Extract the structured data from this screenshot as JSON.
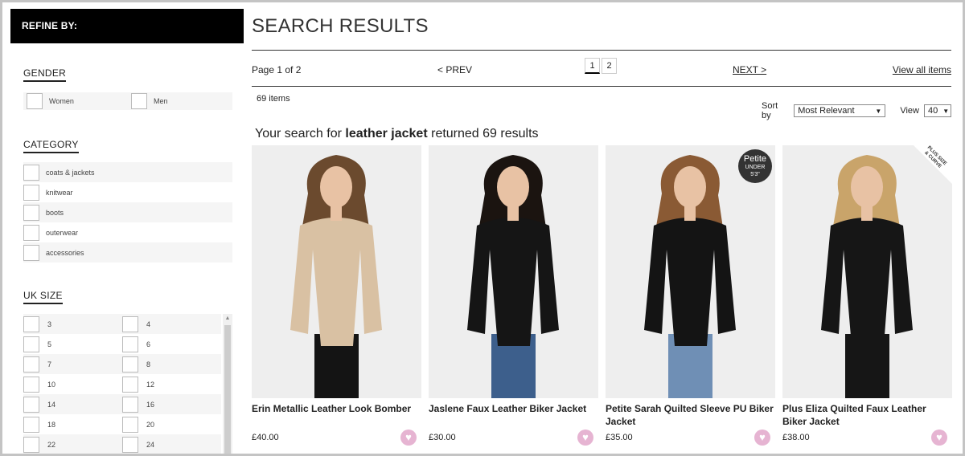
{
  "sidebar": {
    "refine_label": "REFINE BY:",
    "gender": {
      "title": "GENDER",
      "options": [
        "Women",
        "Men"
      ]
    },
    "category": {
      "title": "CATEGORY",
      "options": [
        "coats & jackets",
        "knitwear",
        "boots",
        "outerwear",
        "accessories"
      ]
    },
    "size": {
      "title": "UK SIZE",
      "rows": [
        [
          "3",
          "4"
        ],
        [
          "5",
          "6"
        ],
        [
          "7",
          "8"
        ],
        [
          "10",
          "12"
        ],
        [
          "14",
          "16"
        ],
        [
          "18",
          "20"
        ],
        [
          "22",
          "24"
        ]
      ]
    }
  },
  "main": {
    "title": "SEARCH RESULTS",
    "pager": {
      "page_info": "Page 1 of 2",
      "prev": "< PREV",
      "pages": [
        "1",
        "2"
      ],
      "next": "NEXT >",
      "view_all": "View all items"
    },
    "item_count": "69 items",
    "sort_label": "Sort by",
    "sort_value": "Most Relevant",
    "view_label": "View",
    "view_value": "40",
    "search_msg": {
      "prefix": "Your search for",
      "term": "leather jacket",
      "suffix": "returned 69 results"
    },
    "products": [
      {
        "name": "Erin Metallic Leather Look Bomber",
        "price": "£40.00",
        "jacket_color": "#d9c1a3",
        "shirt_color": "#111111",
        "bottom_color": "#141414",
        "hair_color": "#6b4a2e",
        "bg": "#eeeeee"
      },
      {
        "name": "Jaslene Faux Leather Biker Jacket",
        "price": "£30.00",
        "jacket_color": "#151515",
        "shirt_color": "#f2f2f2",
        "bottom_color": "#3d5f8c",
        "hair_color": "#1b1410",
        "bg": "#eeeeee"
      },
      {
        "name": "Petite Sarah Quilted Sleeve PU Biker Jacket",
        "price": "£35.00",
        "jacket_color": "#141414",
        "shirt_color": "#f4f4f4",
        "bottom_color": "#6f8fb5",
        "hair_color": "#8a5a34",
        "bg": "#eeeeee",
        "badge": {
          "line1": "Petite",
          "line2": "UNDER",
          "line3": "5'3\""
        }
      },
      {
        "name": "Plus Eliza Quilted Faux Leather Biker Jacket",
        "price": "£38.00",
        "jacket_color": "#161616",
        "shirt_color": "#b9b9b9",
        "bottom_color": "#161616",
        "hair_color": "#c9a46a",
        "bg": "#eeeeee",
        "badge_plus": {
          "line1": "PLUS SIZE",
          "line2": "& CURVE"
        }
      }
    ]
  }
}
